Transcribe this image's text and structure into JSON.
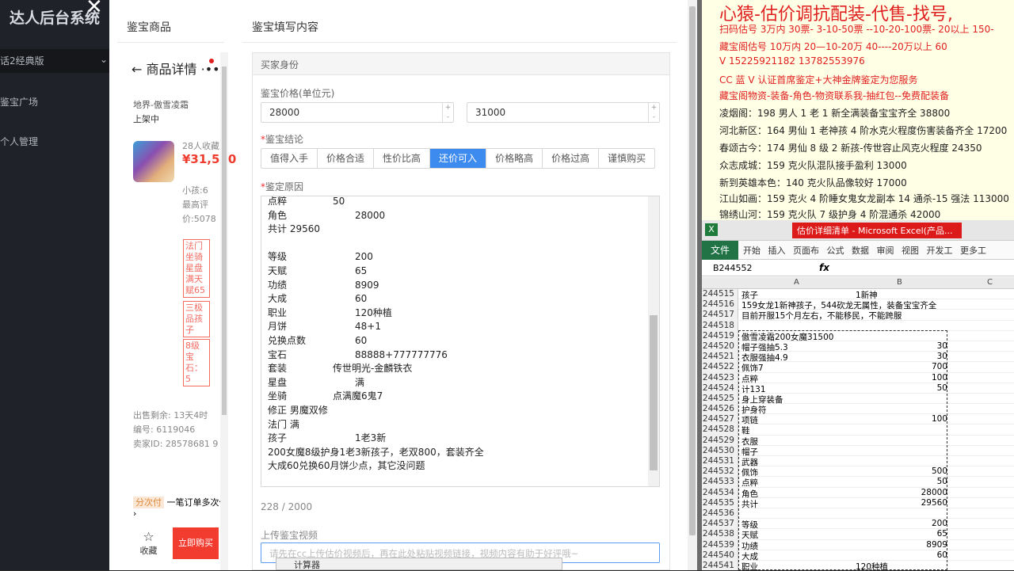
{
  "sidebar": {
    "title": "达人后台系统",
    "version": "话2经典版",
    "items": [
      {
        "label": "鉴宝广场"
      },
      {
        "label": "个人管理"
      }
    ]
  },
  "modal": {
    "left_title": "鉴宝商品",
    "right_title": "鉴宝填写内容"
  },
  "product": {
    "header": "商品详情",
    "server": "地界-傲雪凌霜",
    "status": "上架中",
    "favorites": "28人收藏",
    "price": "¥31,500",
    "meta": "小孩:6 最高评价:5078",
    "tags": [
      "法门坐骑星盘满天赋65",
      "三极品孩子",
      "8级宝石：5"
    ],
    "stats": [
      {
        "k": "出售剩余:",
        "v": "13天4时"
      },
      {
        "k": "编号:",
        "v": "6119046"
      },
      {
        "k": "卖家ID:",
        "v": "28578681 9"
      }
    ],
    "installment_badge": "分次付",
    "installment_text": "一笔订单多次付",
    "fav_label": "收藏",
    "buy_label": "立即购买"
  },
  "form": {
    "section": "买家身份",
    "price_label": "鉴宝价格(单位元)",
    "price_min": "28000",
    "price_max": "31000",
    "conclusion_label": "鉴宝结论",
    "conclusions": [
      "值得入手",
      "价格合适",
      "性价比高",
      "还价可入",
      "价格略高",
      "价格过高",
      "谨慎购买"
    ],
    "selected_conclusion": "还价可入",
    "reason_label": "鉴定原因",
    "reason_lines": [
      {
        "k": "点粹",
        "v": "50",
        "off": 1
      },
      {
        "k": "角色",
        "v": "28000"
      },
      {
        "k": "共计 29560",
        "v": ""
      },
      {
        "k": "",
        "v": ""
      },
      {
        "k": "等级",
        "v": "200"
      },
      {
        "k": "天赋",
        "v": "65"
      },
      {
        "k": "功绩",
        "v": "8909"
      },
      {
        "k": "大成",
        "v": "60"
      },
      {
        "k": "职业",
        "v": "120种植"
      },
      {
        "k": "月饼",
        "v": "48+1"
      },
      {
        "k": "兑换点数",
        "v": "60"
      },
      {
        "k": "宝石",
        "v": "88888+777777776"
      },
      {
        "k": "套装",
        "v": "传世明光-金麟铁衣",
        "off": 1
      },
      {
        "k": "星盘",
        "v": "满"
      },
      {
        "k": "坐骑",
        "v": "点满魔6鬼7",
        "off": 1
      },
      {
        "k": "修正 男魔双修",
        "v": ""
      },
      {
        "k": "法门 满",
        "v": ""
      },
      {
        "k": "孩子",
        "v": "1老3新"
      },
      {
        "k": "200女魔8级护身1老3新孩子，老双800，套装齐全",
        "v": ""
      },
      {
        "k": "大成60兑换60月饼少点，其它没问题",
        "v": ""
      }
    ],
    "counter": "228 / 2000",
    "upload_label": "上传鉴宝视频",
    "video_placeholder": "请先在cc上传估价视频后，再在此处粘贴视频链接，视频内容有助于好评哦~"
  },
  "taskbar": {
    "calc_label": "计算器"
  },
  "ad": {
    "lines": [
      {
        "t": "心猿-估价调抗配装-代售-找号,",
        "c": "big"
      },
      {
        "t": "扫码估号 3万内 30票- 3-10-50票 --10-20-100票- 20以上 150-",
        "c": "red"
      },
      {
        "t": "藏宝阁估号 10万内 20—10-20万 40----20万以上 60",
        "c": "red"
      },
      {
        "t": " V 15225921182          13782553976",
        "c": "red"
      },
      {
        "t": "CC 蓝 V 认证首席鉴定+大神金牌鉴定为您服务",
        "c": "red"
      },
      {
        "t": "藏宝阁物资-装备-角色-物资联系我-抽红包--免费配装备",
        "c": "red"
      },
      {
        "t": "凌烟阁：198 男人 1 老 1 新全满装备宝宝齐全 38800",
        "c": "blk"
      },
      {
        "t": "河北新区：164 男仙 1 老神孩 4 阶水克火程度伤害装备齐全 17200",
        "c": "blk"
      },
      {
        "t": "春颂古今：174 男仙 8 级 2 新孩-传世容止风克火程度 24350",
        "c": "blk"
      },
      {
        "t": "众志成城：159 克火队混队接手盈利 13000",
        "c": "blk"
      },
      {
        "t": "新到英雄本色：140 克火队品像较好 17000",
        "c": "blk"
      },
      {
        "t": "江山如画：159 克火 4 阶睡女鬼女龙副本 14 通杀-15 强法 113000",
        "c": "blk"
      },
      {
        "t": "锦绣山河：159 克火队 7 级护身 4 阶混通杀 42000",
        "c": "blk"
      }
    ]
  },
  "excel": {
    "title": "估价详细清单 - Microsoft Excel(产品...",
    "file_tab": "文件",
    "tabs": "开始 插入 页面布 公式 数据 审阅 视图 开发工 更多工",
    "cell_ref": "B244552",
    "fx": "fx",
    "cols": [
      "A",
      "B",
      "C"
    ],
    "rows": [
      {
        "n": "244515",
        "a": "孩子",
        "b2": "1新神"
      },
      {
        "n": "244516",
        "a": "159女龙1新神孩子，544砍龙无属性，装备宝宝齐全"
      },
      {
        "n": "244517",
        "a": "目前开服15个月左右，不能移民，不能跨服"
      },
      {
        "n": "244518",
        "a": ""
      },
      {
        "n": "244519",
        "a": "傲雪凌霜200女魔31500"
      },
      {
        "n": "244520",
        "a": "帽子强抽5.3",
        "b": "30"
      },
      {
        "n": "244521",
        "a": "衣服强抽4.9",
        "b": "30"
      },
      {
        "n": "244522",
        "a": "佩饰7",
        "b": "700"
      },
      {
        "n": "244523",
        "a": "点粹",
        "b": "100"
      },
      {
        "n": "244524",
        "a": "计131",
        "b": "50"
      },
      {
        "n": "244525",
        "a": "身上穿装备"
      },
      {
        "n": "244526",
        "a": "护身符"
      },
      {
        "n": "244527",
        "a": "项链",
        "b": "100"
      },
      {
        "n": "244528",
        "a": "鞋"
      },
      {
        "n": "244529",
        "a": "衣服"
      },
      {
        "n": "244530",
        "a": "帽子"
      },
      {
        "n": "244531",
        "a": "武器"
      },
      {
        "n": "244532",
        "a": "佩饰",
        "b": "500"
      },
      {
        "n": "244533",
        "a": "点粹",
        "b": "50"
      },
      {
        "n": "244534",
        "a": "角色",
        "b": "28000"
      },
      {
        "n": "244535",
        "a": "共计",
        "b": "29560"
      },
      {
        "n": "244536",
        "a": ""
      },
      {
        "n": "244537",
        "a": "等级",
        "b": "200"
      },
      {
        "n": "244538",
        "a": "天赋",
        "b": "65"
      },
      {
        "n": "244539",
        "a": "功绩",
        "b": "8909"
      },
      {
        "n": "244540",
        "a": "大成",
        "b": "60"
      },
      {
        "n": "244541",
        "a": "职业",
        "b2": "120种植"
      }
    ]
  }
}
